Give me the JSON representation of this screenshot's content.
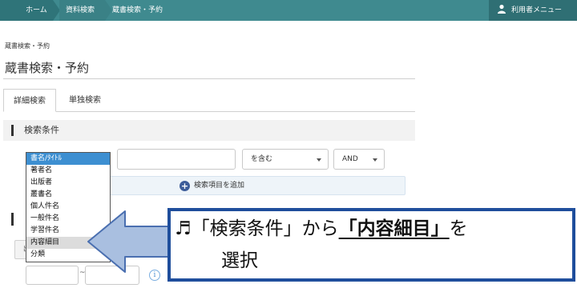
{
  "breadcrumb": {
    "home": "ホーム",
    "level2": "資料検索",
    "current": "蔵書検索・予約"
  },
  "user_menu": {
    "label": "利用者メニュー",
    "icon": "user-icon"
  },
  "header": {
    "small_title": "蔵書検索・予約",
    "page_title": "蔵書検索・予約"
  },
  "tabs": [
    {
      "label": "詳細検索",
      "active": true
    },
    {
      "label": "単独検索",
      "active": false
    }
  ],
  "section": {
    "title": "検索条件"
  },
  "search_row": {
    "match_select": "を含む",
    "logic_select": "AND"
  },
  "add_condition": {
    "label": "検索項目を追加",
    "icon": "plus-circle-icon"
  },
  "field_options": [
    "書名/ﾀｲﾄﾙ",
    "著者名",
    "出版者",
    "叢書名",
    "個人件名",
    "一般件名",
    "学習件名",
    "内容細目",
    "分類"
  ],
  "selected_option_index": 0,
  "highlighted_option_index": 7,
  "date_range": {
    "separator": "~"
  },
  "lower_button_fragment": "出",
  "callout": {
    "icon": "music-note-icon",
    "line1_prefix": "♬「検索条件」から",
    "line1_emphasis": "「内容細目」",
    "line1_suffix": "を",
    "line2": "選択"
  },
  "colors": {
    "topbar": "#3f8a8f",
    "selected_option": "#3d8fd1",
    "callout_border": "#1f4e9c",
    "arrow_fill": "#a9bfe0",
    "arrow_stroke": "#4a6fb0"
  }
}
